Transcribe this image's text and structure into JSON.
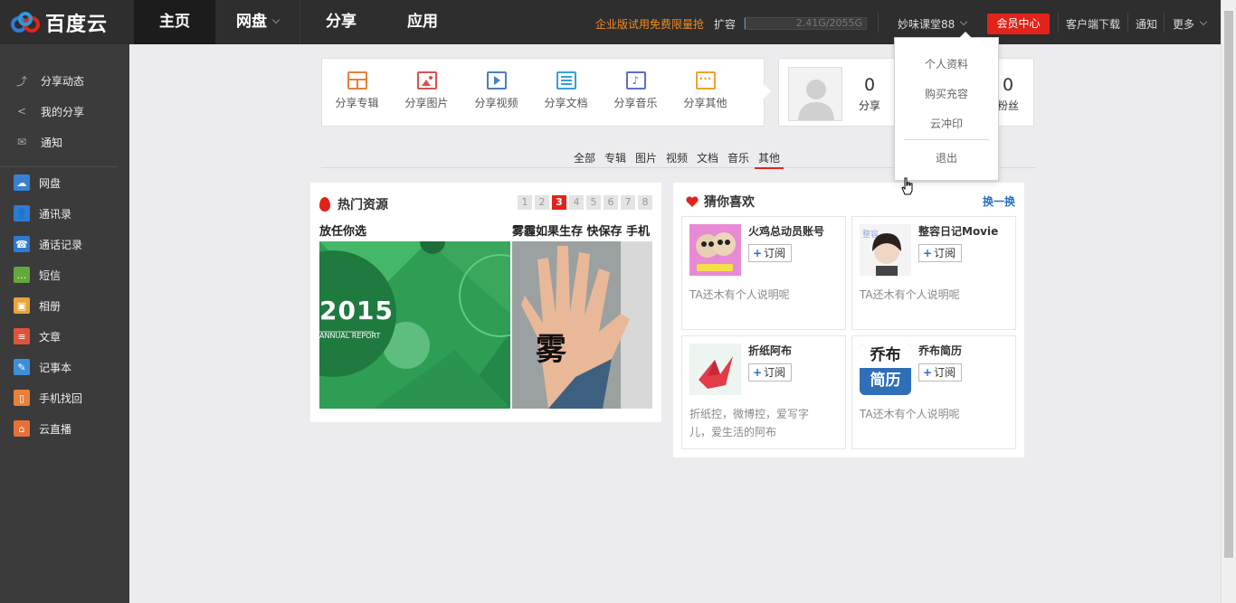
{
  "app": {
    "brand": "百度云"
  },
  "nav": {
    "home": "主页",
    "disk": "网盘",
    "share": "分享",
    "apps": "应用"
  },
  "topbar": {
    "promo": "企业版试用免费限量抢",
    "expand": "扩容",
    "quota": "2.41G/2055G",
    "quota_fraction": 0.0012,
    "username": "妙味课堂88",
    "vip": "会员中心",
    "download": "客户端下载",
    "notify": "通知",
    "more": "更多"
  },
  "sidebar": {
    "items": [
      {
        "label": "分享动态",
        "icon": "activity-icon"
      },
      {
        "label": "我的分享",
        "icon": "share-icon"
      },
      {
        "label": "通知",
        "icon": "mail-icon"
      },
      {
        "label": "网盘",
        "icon": "cloud-icon",
        "color": "#3a7fd5"
      },
      {
        "label": "通讯录",
        "icon": "contact-icon",
        "color": "#2f7bd0"
      },
      {
        "label": "通话记录",
        "icon": "phone-icon",
        "color": "#2f7bd0"
      },
      {
        "label": "短信",
        "icon": "sms-icon",
        "color": "#63a83a"
      },
      {
        "label": "相册",
        "icon": "photo-icon",
        "color": "#e8a33a"
      },
      {
        "label": "文章",
        "icon": "article-icon",
        "color": "#e0533a"
      },
      {
        "label": "记事本",
        "icon": "notepad-icon",
        "color": "#3f8fd8"
      },
      {
        "label": "手机找回",
        "icon": "phone-find-icon",
        "color": "#e8803a"
      },
      {
        "label": "云直播",
        "icon": "live-icon",
        "color": "#e8703a"
      }
    ]
  },
  "sharebar": {
    "items": [
      {
        "label": "分享专辑",
        "icon": "album-icon",
        "color": "#e8803a"
      },
      {
        "label": "分享图片",
        "icon": "image-icon",
        "color": "#d9534f"
      },
      {
        "label": "分享视频",
        "icon": "video-icon",
        "color": "#4a7fc0"
      },
      {
        "label": "分享文档",
        "icon": "document-icon",
        "color": "#3a9fd5"
      },
      {
        "label": "分享音乐",
        "icon": "music-icon",
        "color": "#5b6fc8"
      },
      {
        "label": "分享其他",
        "icon": "other-icon",
        "color": "#f0a030"
      }
    ]
  },
  "profile": {
    "stats": [
      {
        "num": "0",
        "label": "分享"
      },
      {
        "num": "0",
        "label": "粉丝"
      }
    ]
  },
  "filters": {
    "tabs": [
      "全部",
      "专辑",
      "图片",
      "视频",
      "文档",
      "音乐",
      "其他"
    ],
    "active": "其他"
  },
  "hot": {
    "title": "热门资源",
    "pages": [
      "1",
      "2",
      "3",
      "4",
      "5",
      "6",
      "7",
      "8"
    ],
    "active_page": "3",
    "captions": [
      "放任你选",
      "雾霾如果生存 快保存 手机"
    ],
    "img1_text": "2015",
    "img1_sub": "ANNUAL   REPORT",
    "img2_text": "雾"
  },
  "guess": {
    "title": "猜你喜欢",
    "refresh": "换一换",
    "subscribe": "订阅",
    "cards": [
      {
        "name": "火鸡总动员账号",
        "desc": "TA还木有个人说明呢"
      },
      {
        "name": "整容日记Movie",
        "desc": "TA还木有个人说明呢"
      },
      {
        "name": "折纸阿布",
        "desc": "折纸控，微博控，爱写字儿，爱生活的阿布"
      },
      {
        "name": "乔布简历",
        "desc": "TA还木有个人说明呢",
        "logo_top": "乔布",
        "logo_bottom": "简历"
      }
    ]
  },
  "dropdown": {
    "items": [
      "个人资料",
      "购买充容",
      "云冲印",
      "退出"
    ]
  }
}
